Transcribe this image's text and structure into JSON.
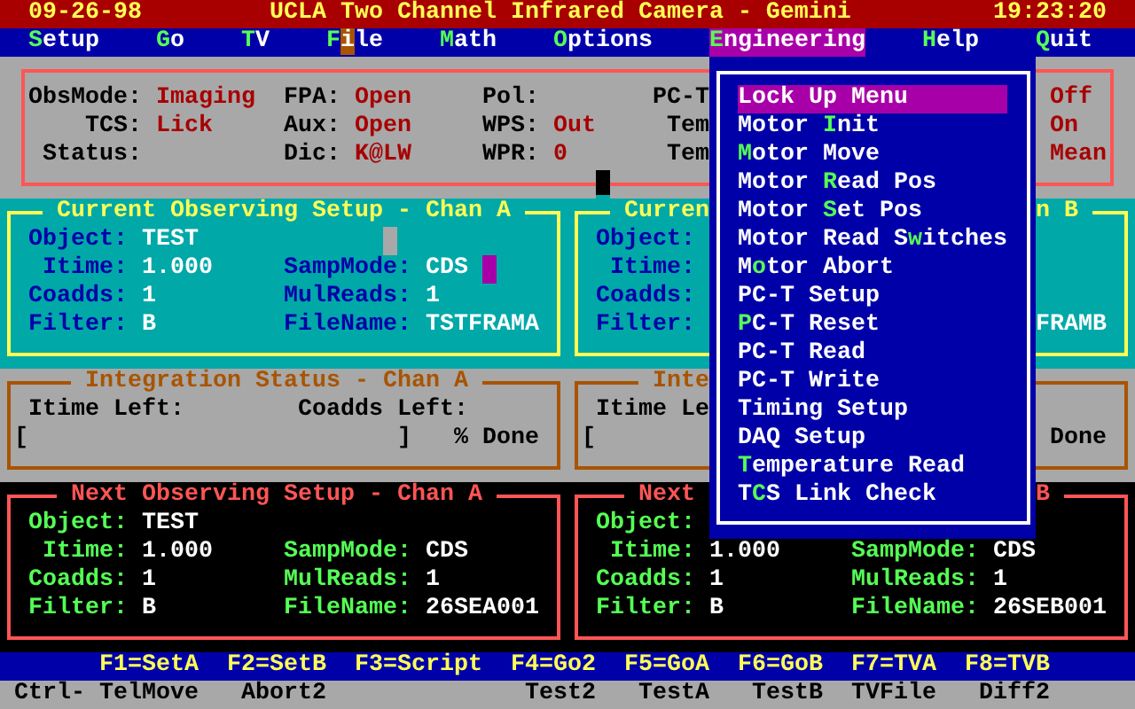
{
  "title_bar": {
    "date": "09-26-98",
    "title": "UCLA Two Channel Infrared Camera - Gemini",
    "time": "19:23:20"
  },
  "menu_bar": [
    {
      "selected": false,
      "label": [
        {
          "text": "S",
          "kind": "hotkey"
        },
        {
          "text": "etup",
          "kind": "plain"
        }
      ]
    },
    {
      "selected": false,
      "label": [
        {
          "text": "G",
          "kind": "hotkey"
        },
        {
          "text": "o",
          "kind": "plain"
        }
      ]
    },
    {
      "selected": false,
      "label": [
        {
          "text": "T",
          "kind": "hotkey"
        },
        {
          "text": "V",
          "kind": "plain"
        }
      ]
    },
    {
      "selected": false,
      "label": [
        {
          "text": "F",
          "kind": "hotkey"
        },
        {
          "text": "i",
          "kind": "cursor"
        },
        {
          "text": "le",
          "kind": "plain"
        }
      ]
    },
    {
      "selected": false,
      "label": [
        {
          "text": "M",
          "kind": "hotkey"
        },
        {
          "text": "ath",
          "kind": "plain"
        }
      ]
    },
    {
      "selected": false,
      "label": [
        {
          "text": "O",
          "kind": "hotkey"
        },
        {
          "text": "ptions",
          "kind": "plain"
        }
      ]
    },
    {
      "selected": true,
      "label": [
        {
          "text": "E",
          "kind": "hotkey"
        },
        {
          "text": "ngineering",
          "kind": "plain"
        }
      ]
    },
    {
      "selected": false,
      "label": [
        {
          "text": "H",
          "kind": "hotkey"
        },
        {
          "text": "elp",
          "kind": "plain"
        }
      ]
    },
    {
      "selected": false,
      "label": [
        {
          "text": "Q",
          "kind": "hotkey"
        },
        {
          "text": "uit",
          "kind": "plain"
        }
      ]
    }
  ],
  "status_panel": {
    "columns": [
      [
        {
          "label": "ObsMode:",
          "value": "Imaging"
        },
        {
          "label": "TCS:",
          "value": "Lick"
        },
        {
          "label": "Status:"
        }
      ],
      [
        {
          "label": "FPA:",
          "value": "Open"
        },
        {
          "label": "Aux:",
          "value": "Open"
        },
        {
          "label": "Dic:",
          "value": "K@LW"
        }
      ],
      [
        {
          "label": "Pol:"
        },
        {
          "label": "WPS:",
          "value": "Out"
        },
        {
          "label": "WPR:",
          "value": "0"
        }
      ],
      [
        {
          "label": "PC-T"
        },
        {
          "label": "Tem"
        },
        {
          "label": "Tem"
        }
      ],
      [
        {
          "value": "Off"
        },
        {
          "value": "On"
        },
        {
          "value": "Mean"
        }
      ]
    ]
  },
  "current_setup": [
    {
      "title": [
        "Current Observing Setup - Chan A"
      ],
      "rows": [
        [
          {
            "label": "Object:",
            "value": "TEST"
          }
        ],
        [
          {
            "label": "Itime:",
            "value": "1.000"
          },
          {
            "label": "SampMode:",
            "value": "CDS"
          }
        ],
        [
          {
            "label": "Coadds:",
            "value": "1"
          },
          {
            "label": "MulReads:",
            "value": "1"
          }
        ],
        [
          {
            "label": "Filter:",
            "value": "B"
          },
          {
            "label": "FileName:",
            "value": "TSTFRAMA"
          }
        ]
      ]
    },
    {
      "title": [
        "Curren",
        "n B"
      ],
      "rows": [
        [
          {
            "label": "Object:"
          }
        ],
        [
          {
            "label": "Itime:"
          }
        ],
        [
          {
            "label": "Coadds:"
          }
        ],
        [
          {
            "label": "Filter:"
          },
          {
            "value_end": "FRAMB"
          }
        ]
      ]
    }
  ],
  "integration_status": [
    {
      "title": [
        "Integration Status - Chan A"
      ],
      "labels": [
        "Itime Left:",
        "Coadds Left:"
      ],
      "bar": {
        "open": "[",
        "close": "]",
        "done": "% Done"
      }
    },
    {
      "title": [
        "Inte"
      ],
      "labels": [
        "Itime Le"
      ],
      "bar": {
        "open": "[",
        "done": "Done"
      }
    }
  ],
  "next_setup": [
    {
      "title": [
        "Next Observing Setup - Chan A"
      ],
      "rows": [
        [
          {
            "label": "Object:",
            "value": "TEST"
          }
        ],
        [
          {
            "label": "Itime:",
            "value": "1.000"
          },
          {
            "label": "SampMode:",
            "value": "CDS"
          }
        ],
        [
          {
            "label": "Coadds:",
            "value": "1"
          },
          {
            "label": "MulReads:",
            "value": "1"
          }
        ],
        [
          {
            "label": "Filter:",
            "value": "B"
          },
          {
            "label": "FileName:",
            "value": "26SEA001"
          }
        ]
      ]
    },
    {
      "title": [
        "Next",
        "B"
      ],
      "rows": [
        [
          {
            "label": "Object:"
          }
        ],
        [
          {
            "label": "Itime:",
            "value": "1.000"
          },
          {
            "label": "SampMode:",
            "value": "CDS"
          }
        ],
        [
          {
            "label": "Coadds:",
            "value": "1"
          },
          {
            "label": "MulReads:",
            "value": "1"
          }
        ],
        [
          {
            "label": "Filter:",
            "value": "B"
          },
          {
            "label": "FileName:",
            "value": "26SEB001"
          }
        ]
      ]
    }
  ],
  "engineering_menu": {
    "items": [
      {
        "selected": true,
        "label": [
          {
            "text": "Lock Up Menu",
            "kind": "plain"
          }
        ]
      },
      {
        "selected": false,
        "label": [
          {
            "text": "Motor ",
            "kind": "plain"
          },
          {
            "text": "I",
            "kind": "hotkey"
          },
          {
            "text": "nit",
            "kind": "plain"
          }
        ]
      },
      {
        "selected": false,
        "label": [
          {
            "text": "M",
            "kind": "hotkey"
          },
          {
            "text": "otor Move",
            "kind": "plain"
          }
        ]
      },
      {
        "selected": false,
        "label": [
          {
            "text": "Motor ",
            "kind": "plain"
          },
          {
            "text": "R",
            "kind": "hotkey"
          },
          {
            "text": "ead Pos",
            "kind": "plain"
          }
        ]
      },
      {
        "selected": false,
        "label": [
          {
            "text": "Motor ",
            "kind": "plain"
          },
          {
            "text": "S",
            "kind": "hotkey"
          },
          {
            "text": "et Pos",
            "kind": "plain"
          }
        ]
      },
      {
        "selected": false,
        "label": [
          {
            "text": "Motor Read S",
            "kind": "plain"
          },
          {
            "text": "w",
            "kind": "hotkey"
          },
          {
            "text": "itches",
            "kind": "plain"
          }
        ]
      },
      {
        "selected": false,
        "label": [
          {
            "text": "M",
            "kind": "plain"
          },
          {
            "text": "o",
            "kind": "hotkey"
          },
          {
            "text": "tor Abort",
            "kind": "plain"
          }
        ]
      },
      {
        "selected": false,
        "label": [
          {
            "text": "PC-T Setup",
            "kind": "plain"
          }
        ]
      },
      {
        "selected": false,
        "label": [
          {
            "text": "P",
            "kind": "hotkey"
          },
          {
            "text": "C-T Reset",
            "kind": "plain"
          }
        ]
      },
      {
        "selected": false,
        "label": [
          {
            "text": "PC-T Read",
            "kind": "plain"
          }
        ]
      },
      {
        "selected": false,
        "label": [
          {
            "text": "PC-T Write",
            "kind": "plain"
          }
        ]
      },
      {
        "selected": false,
        "label": [
          {
            "text": "Timing Setup",
            "kind": "plain"
          }
        ]
      },
      {
        "selected": false,
        "label": [
          {
            "text": "DAQ Setup",
            "kind": "plain"
          }
        ]
      },
      {
        "selected": false,
        "label": [
          {
            "text": "T",
            "kind": "hotkey"
          },
          {
            "text": "emperature Read",
            "kind": "plain"
          }
        ]
      },
      {
        "selected": false,
        "label": [
          {
            "text": "T",
            "kind": "plain"
          },
          {
            "text": "C",
            "kind": "hotkey"
          },
          {
            "text": "S Link Check",
            "kind": "plain"
          }
        ]
      }
    ]
  },
  "function_keys": [
    "F1=SetA",
    "F2=SetB",
    "F3=Script",
    "F4=Go2",
    "F5=GoA",
    "F6=GoB",
    "F7=TVA",
    "F8=TVB"
  ],
  "ctrl_keys": [
    "Ctrl-",
    "TelMove",
    "Abort2",
    "Test2",
    "TestA",
    "TestB",
    "TVFile",
    "Diff2"
  ]
}
